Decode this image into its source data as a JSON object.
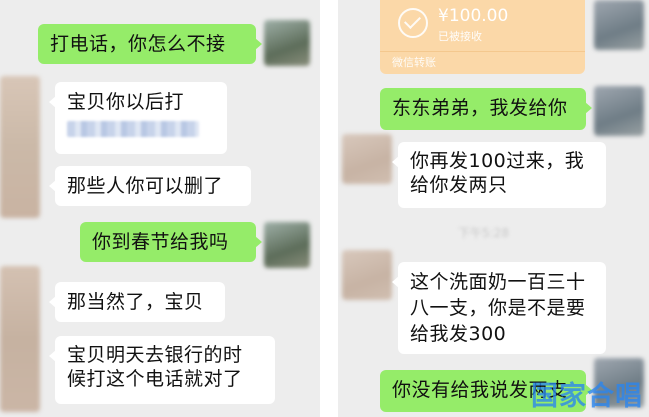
{
  "left_chat": {
    "messages": [
      {
        "side": "me",
        "text": "打电话，你怎么不接"
      },
      {
        "side": "other",
        "text": "宝贝你以后打"
      },
      {
        "side": "other",
        "text": "那些人你可以删了"
      },
      {
        "side": "me",
        "text": "你到春节给我吗"
      },
      {
        "side": "other",
        "text": "那当然了，宝贝"
      },
      {
        "side": "other",
        "line1": "宝贝明天去银行的时",
        "line2": "候打这个电话就对了"
      }
    ]
  },
  "right_chat": {
    "transfer": {
      "amount": "¥100.00",
      "status": "已被接收",
      "footer": "微信转账"
    },
    "messages": [
      {
        "side": "me",
        "text": "东东弟弟，我发给你"
      },
      {
        "side": "other",
        "line1": "你再发100过来，我",
        "line2": "给你发两只"
      },
      {
        "side": "other",
        "line1": "这个洗面奶一百三十",
        "line2": "八一支，你是不是要",
        "line3": "给我发300"
      },
      {
        "side": "me",
        "text": "你没有给我说发两支"
      }
    ],
    "timestamp": "下午5:28"
  },
  "watermark": "国家合唱",
  "colors": {
    "chat_background": "#ededed",
    "my_bubble": "#95ec69",
    "other_bubble": "#ffffff",
    "transfer_card": "#fbd8a8",
    "watermark": "#2a86f0"
  },
  "icons": [
    "avatar",
    "check-circle-icon"
  ]
}
